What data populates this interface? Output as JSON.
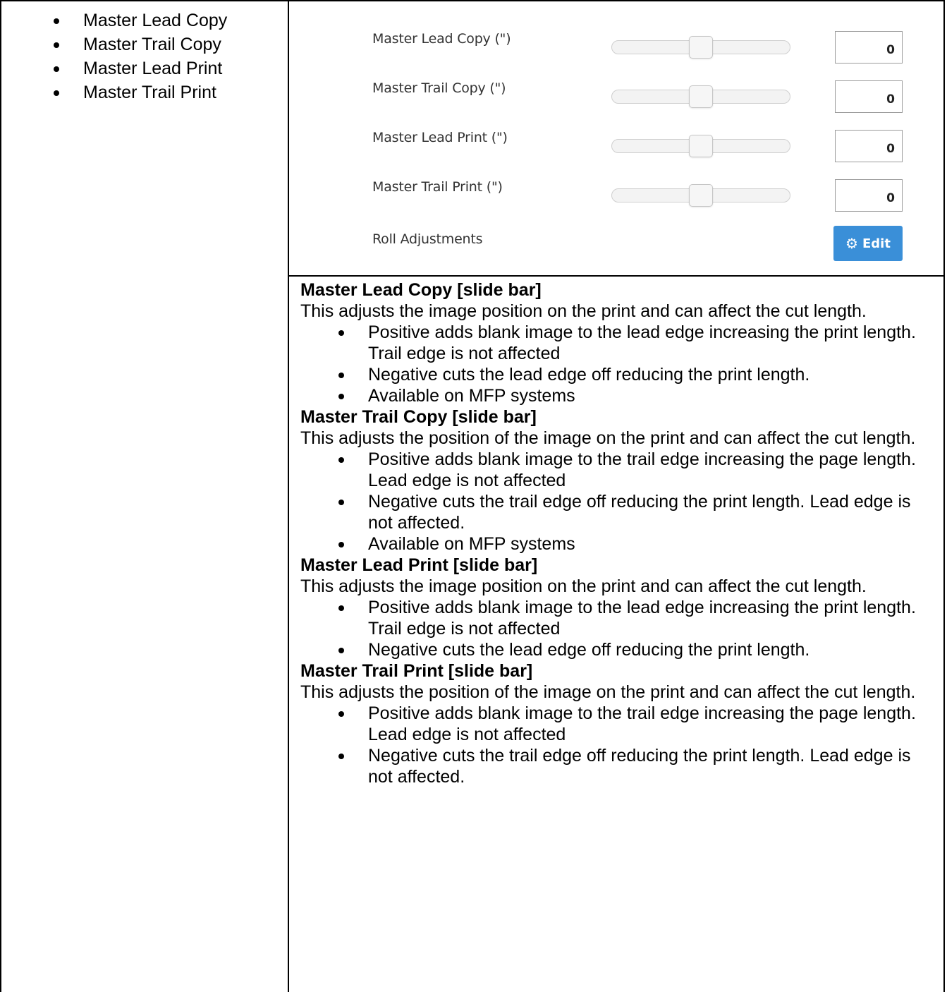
{
  "left_list": [
    "Master Lead Copy",
    "Master Trail Copy",
    "Master Lead Print",
    "Master Trail Print"
  ],
  "screenshot": {
    "settings": [
      {
        "label": "Master Lead Copy (\")",
        "value": "0",
        "slider_position": 0.5
      },
      {
        "label": "Master Trail Copy (\")",
        "value": "0",
        "slider_position": 0.5
      },
      {
        "label": "Master Lead Print (\")",
        "value": "0",
        "slider_position": 0.5
      },
      {
        "label": "Master Trail Print (\")",
        "value": "0",
        "slider_position": 0.5
      }
    ],
    "roll_adjustments_label": "Roll Adjustments",
    "edit_button_label": "Edit",
    "edit_icon": "gear-icon",
    "accent_color": "#3a8fd8"
  },
  "sections": [
    {
      "heading": "Master Lead Copy [slide bar]",
      "intro": "This adjusts the image position on the print and can affect the cut length.",
      "bullets": [
        "Positive adds blank image to the lead edge increasing the print length. Trail edge is not affected",
        "Negative cuts the lead edge off reducing the print length.",
        "Available on MFP systems"
      ]
    },
    {
      "heading": "Master Trail Copy [slide bar]",
      "intro": "This adjusts the position of the image on the print and can affect the cut length.",
      "bullets": [
        "Positive adds blank image to the trail edge increasing the page length. Lead edge is not affected",
        "Negative cuts the trail edge off reducing the print length. Lead edge is not affected.",
        "Available on MFP systems"
      ]
    },
    {
      "heading": "Master Lead Print  [slide bar]",
      "intro": "This adjusts the image position on the print and can affect the cut length.",
      "bullets": [
        "Positive adds blank image to the lead edge increasing the print length. Trail edge is not affected",
        "Negative cuts the lead edge off reducing the print length."
      ]
    },
    {
      "heading": "Master Trail Print  [slide bar]",
      "intro": "This adjusts the position of the image on the print and can affect the cut length.",
      "bullets": [
        "Positive adds blank image to the trail edge increasing the page length. Lead edge is not affected",
        "Negative cuts the trail edge off reducing the print length. Lead edge is not affected."
      ]
    }
  ]
}
